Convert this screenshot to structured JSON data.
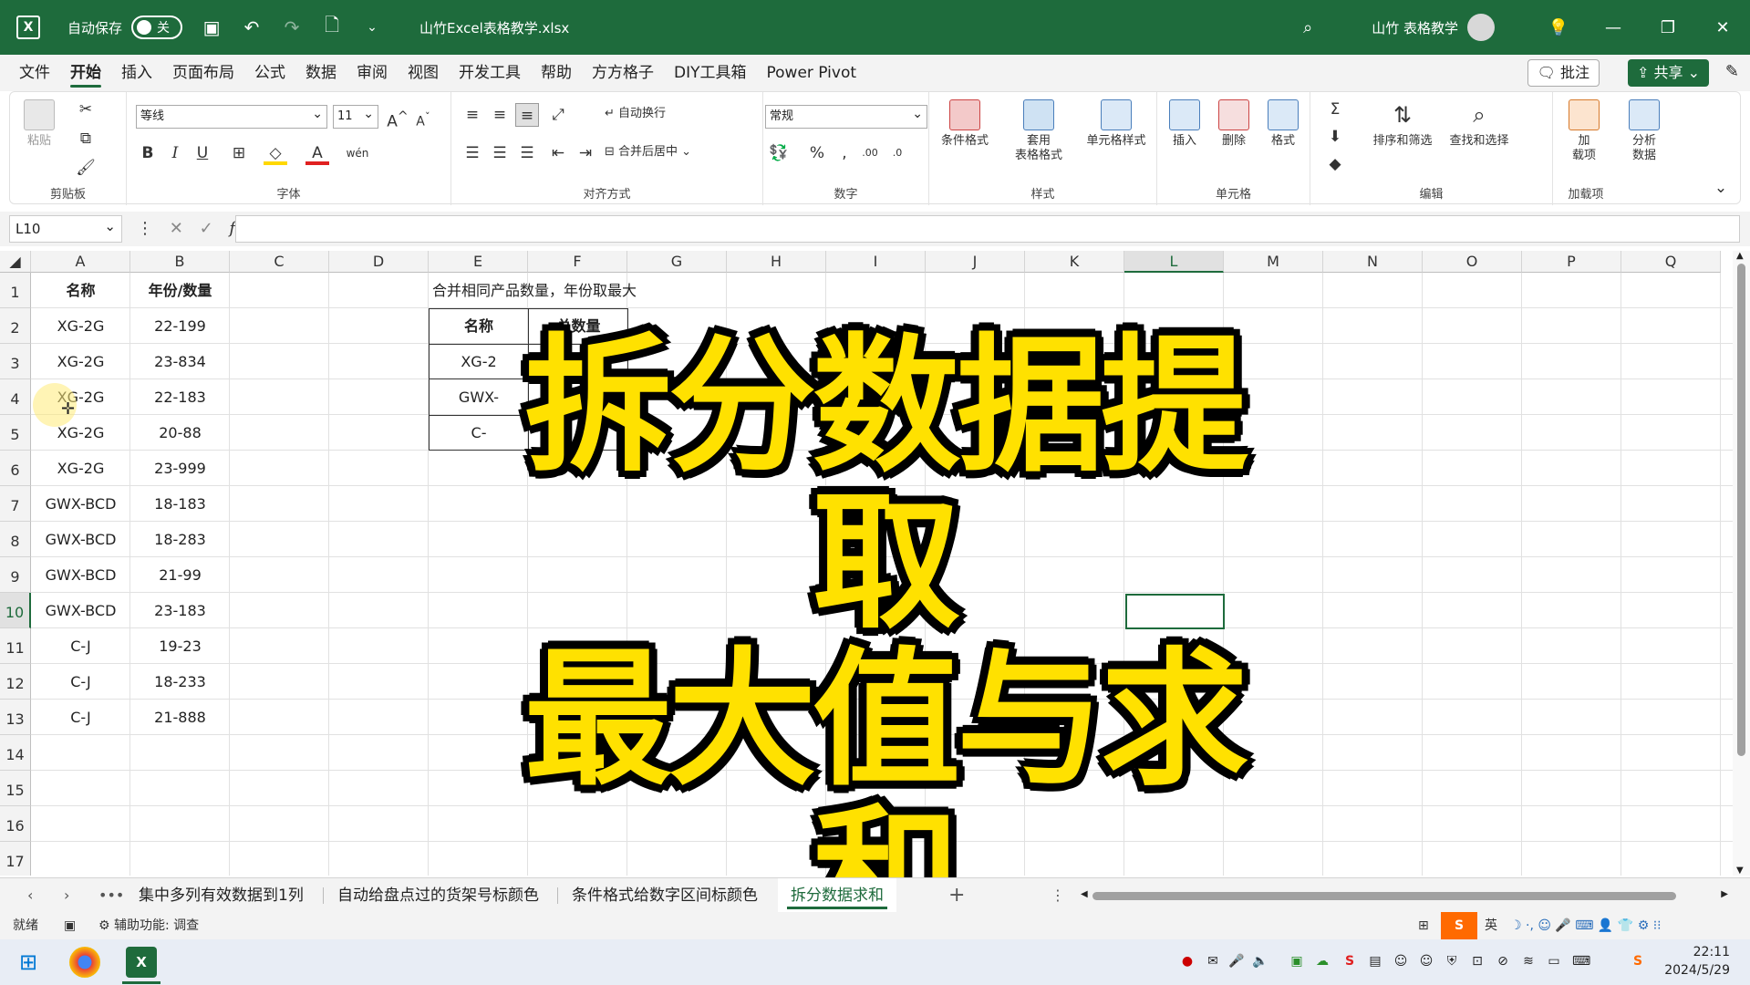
{
  "titlebar": {
    "autosave_label": "自动保存",
    "autosave_state": "关",
    "filename": "山竹Excel表格教学.xlsx",
    "user": "山竹 表格教学"
  },
  "menu": {
    "tabs": [
      "文件",
      "开始",
      "插入",
      "页面布局",
      "公式",
      "数据",
      "审阅",
      "视图",
      "开发工具",
      "帮助",
      "方方格子",
      "DIY工具箱",
      "Power Pivot"
    ],
    "comments": "批注",
    "share": "共享"
  },
  "ribbon": {
    "clipboard": {
      "label": "剪贴板",
      "paste": "粘贴"
    },
    "font": {
      "label": "字体",
      "family": "等线",
      "size": "11"
    },
    "alignment": {
      "label": "对齐方式",
      "wrap": "自动换行",
      "merge": "合并后居中"
    },
    "number": {
      "label": "数字",
      "format": "常规"
    },
    "styles": {
      "label": "样式",
      "conditional": "条件格式",
      "table_format": "套用\n表格格式",
      "cell_styles": "单元格样式"
    },
    "cells": {
      "label": "单元格",
      "insert": "插入",
      "delete": "删除",
      "format": "格式"
    },
    "editing": {
      "label": "编辑",
      "sort": "排序和筛选",
      "find": "查找和选择"
    },
    "addins": {
      "label": "加载项",
      "load": "加\n载项",
      "analyze": "分析\n数据"
    }
  },
  "formula_bar": {
    "name_box": "L10",
    "formula": ""
  },
  "grid": {
    "columns": [
      "A",
      "B",
      "C",
      "D",
      "E",
      "F",
      "G",
      "H",
      "I",
      "J",
      "K",
      "L",
      "M",
      "N",
      "O",
      "P",
      "Q"
    ],
    "rows": [
      "1",
      "2",
      "3",
      "4",
      "5",
      "6",
      "7",
      "8",
      "9",
      "10",
      "11",
      "12",
      "13",
      "14",
      "15",
      "16",
      "17"
    ],
    "selected_col": "L",
    "selected_row": "10",
    "header_a": "名称",
    "header_b": "年份/数量",
    "data": [
      [
        "XG-2G",
        "22-199"
      ],
      [
        "XG-2G",
        "23-834"
      ],
      [
        "XG-2G",
        "22-183"
      ],
      [
        "XG-2G",
        "20-88"
      ],
      [
        "XG-2G",
        "23-999"
      ],
      [
        "GWX-BCD",
        "18-183"
      ],
      [
        "GWX-BCD",
        "18-283"
      ],
      [
        "GWX-BCD",
        "21-99"
      ],
      [
        "GWX-BCD",
        "23-183"
      ],
      [
        "C-J",
        "19-23"
      ],
      [
        "C-J",
        "18-233"
      ],
      [
        "C-J",
        "21-888"
      ]
    ],
    "note": "合并相同产品数量，年份取最大",
    "result_header_name": "名称",
    "result_header_total": "总数量",
    "result_rows": [
      "XG-2",
      "GWX-",
      "C-"
    ]
  },
  "overlay": {
    "line1": "拆分数据提取",
    "line2": "最大值与求和",
    "color": "#ffe100"
  },
  "sheets": {
    "tabs": [
      "集中多列有效数据到1列",
      "自动给盘点过的货架号标颜色",
      "条件格式给数字区间标颜色",
      "拆分数据求和"
    ],
    "active": "拆分数据求和",
    "add": "+"
  },
  "status": {
    "ready": "就绪",
    "accessibility": "辅助功能: 调查"
  },
  "taskbar": {
    "time": "22:11",
    "date": "2024/5/29",
    "ime": "英"
  },
  "colors": {
    "excel_green": "#1e6b3c"
  }
}
